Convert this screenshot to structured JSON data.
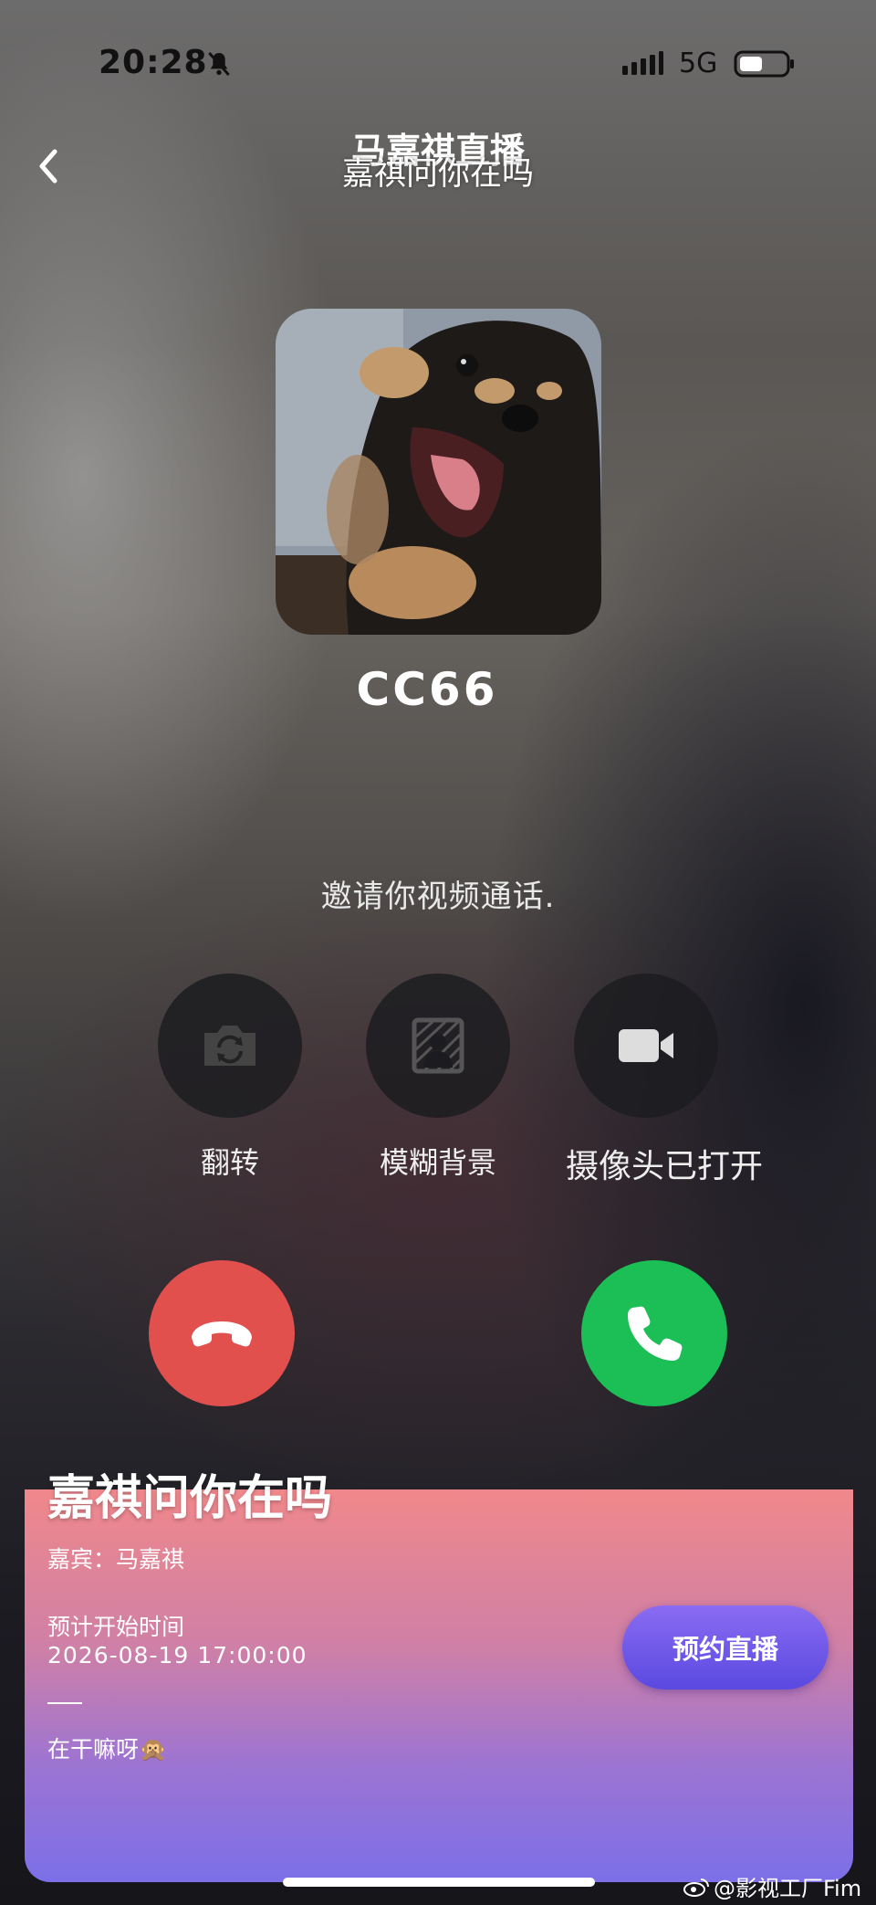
{
  "status_bar": {
    "time": "20:28",
    "network": "5G"
  },
  "header": {
    "title": "马嘉祺直播",
    "subtitle": "嘉祺问你在吗"
  },
  "call": {
    "caller_name": "CC66",
    "invite_text": "邀请你视频通话."
  },
  "controls": [
    {
      "label": "翻转",
      "icon": "camera-flip-icon"
    },
    {
      "label": "模糊背景",
      "icon": "blur-background-icon"
    },
    {
      "label": "摄像头已打开",
      "icon": "video-camera-icon"
    }
  ],
  "call_buttons": {
    "decline_icon": "hang-up-icon",
    "accept_icon": "phone-icon"
  },
  "live_card": {
    "title": "嘉祺问你在吗",
    "guest": "嘉宾：马嘉祺",
    "start_label": "预计开始时间",
    "start_time": "2026-08-19 17:00:00",
    "note": "在干嘛呀🙊",
    "reserve_button": "预约直播"
  },
  "watermark": "@影视工厂Fim",
  "colors": {
    "decline": "#e1504d",
    "accept": "#1bbf56",
    "card_top": "#f0888b",
    "card_bottom": "#7c6fe8",
    "reserve_button": "#6a58e8"
  }
}
